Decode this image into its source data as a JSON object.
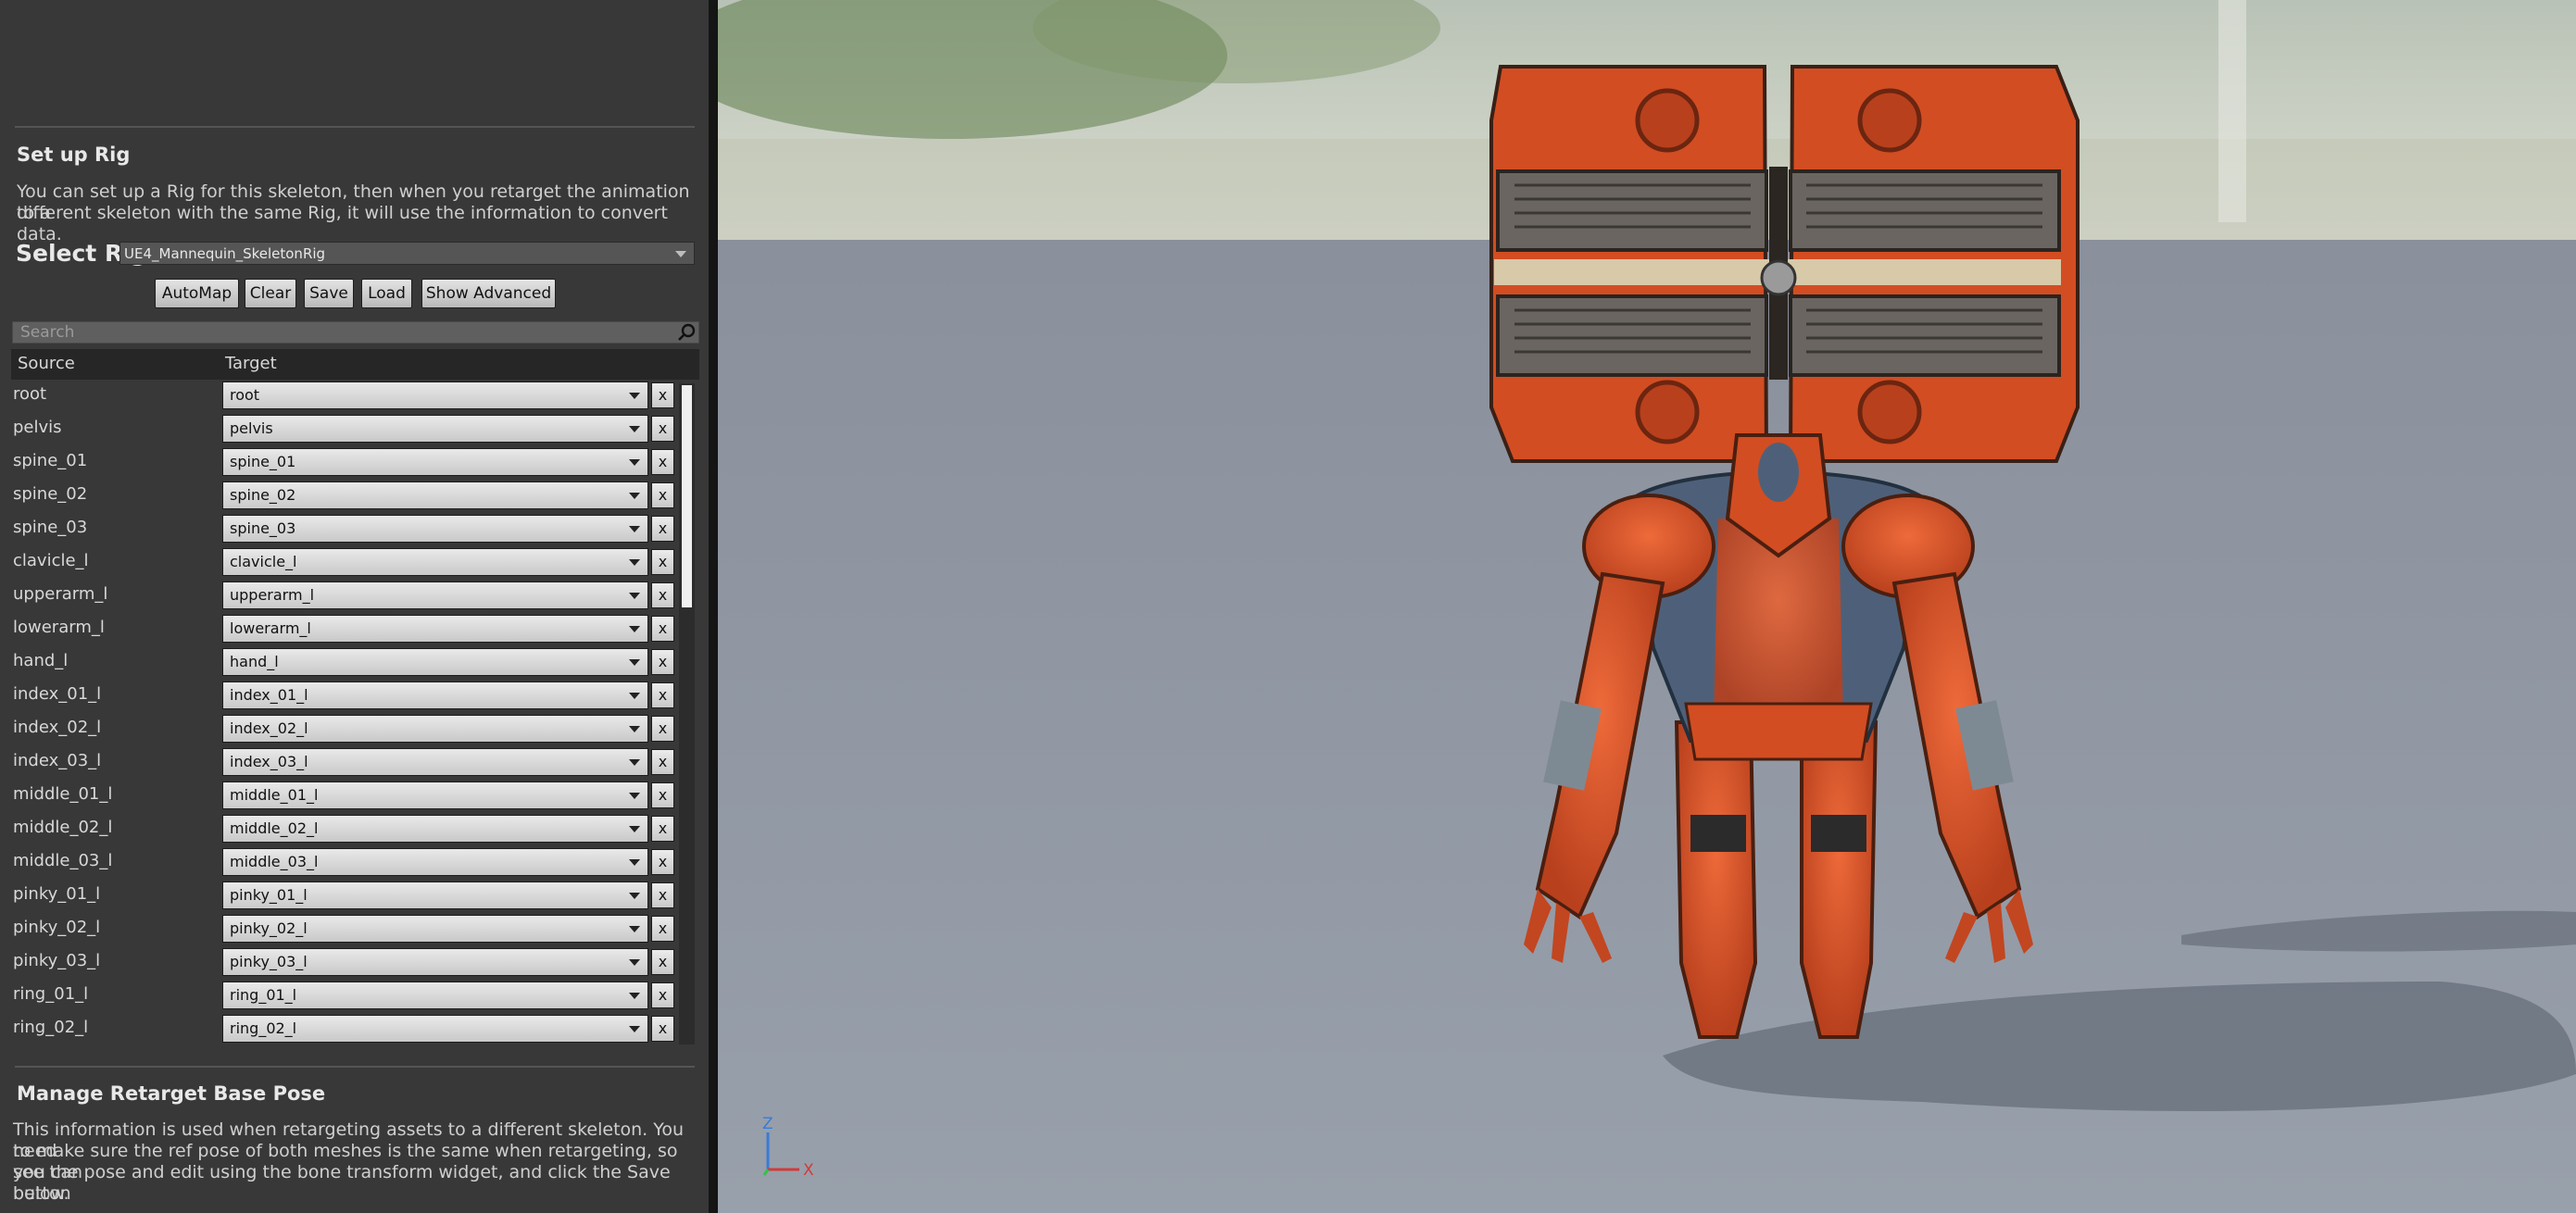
{
  "setup_rig": {
    "heading": "Set up Rig",
    "description_line1": "You can set up a Rig for this skeleton, then when you retarget the animation to a",
    "description_line2": "different skeleton with the same Rig, it will use the information to convert data.",
    "select_label": "Select Rig",
    "selected_rig": "UE4_Mannequin_SkeletonRig"
  },
  "toolbar": {
    "automap": "AutoMap",
    "clear": "Clear",
    "save": "Save",
    "load": "Load",
    "show_advanced": "Show Advanced"
  },
  "search": {
    "placeholder": "Search"
  },
  "table": {
    "headers": {
      "source": "Source",
      "target": "Target"
    },
    "rows": [
      {
        "source": "root",
        "target": "root"
      },
      {
        "source": "pelvis",
        "target": "pelvis"
      },
      {
        "source": "spine_01",
        "target": "spine_01"
      },
      {
        "source": "spine_02",
        "target": "spine_02"
      },
      {
        "source": "spine_03",
        "target": "spine_03"
      },
      {
        "source": "clavicle_l",
        "target": "clavicle_l"
      },
      {
        "source": "upperarm_l",
        "target": "upperarm_l"
      },
      {
        "source": "lowerarm_l",
        "target": "lowerarm_l"
      },
      {
        "source": "hand_l",
        "target": "hand_l"
      },
      {
        "source": "index_01_l",
        "target": "index_01_l"
      },
      {
        "source": "index_02_l",
        "target": "index_02_l"
      },
      {
        "source": "index_03_l",
        "target": "index_03_l"
      },
      {
        "source": "middle_01_l",
        "target": "middle_01_l"
      },
      {
        "source": "middle_02_l",
        "target": "middle_02_l"
      },
      {
        "source": "middle_03_l",
        "target": "middle_03_l"
      },
      {
        "source": "pinky_01_l",
        "target": "pinky_01_l"
      },
      {
        "source": "pinky_02_l",
        "target": "pinky_02_l"
      },
      {
        "source": "pinky_03_l",
        "target": "pinky_03_l"
      },
      {
        "source": "ring_01_l",
        "target": "ring_01_l"
      },
      {
        "source": "ring_02_l",
        "target": "ring_02_l"
      }
    ],
    "clear_glyph": "x"
  },
  "retarget_pose": {
    "heading": "Manage Retarget Base Pose",
    "line1": "This information is used when retargeting assets to a different skeleton. You need",
    "line2": "to make sure the ref pose of both meshes is the same when retargeting, so you can",
    "line3": "see the pose and edit using the bone transform widget, and click the Save button",
    "line4": "below."
  },
  "viewport": {
    "axis_z": "Z",
    "axis_x": "X",
    "colors": {
      "armor": "#d9532a",
      "skin": "#4e6079",
      "floor": "#8f959f",
      "sky": "#c9cfc3"
    }
  }
}
